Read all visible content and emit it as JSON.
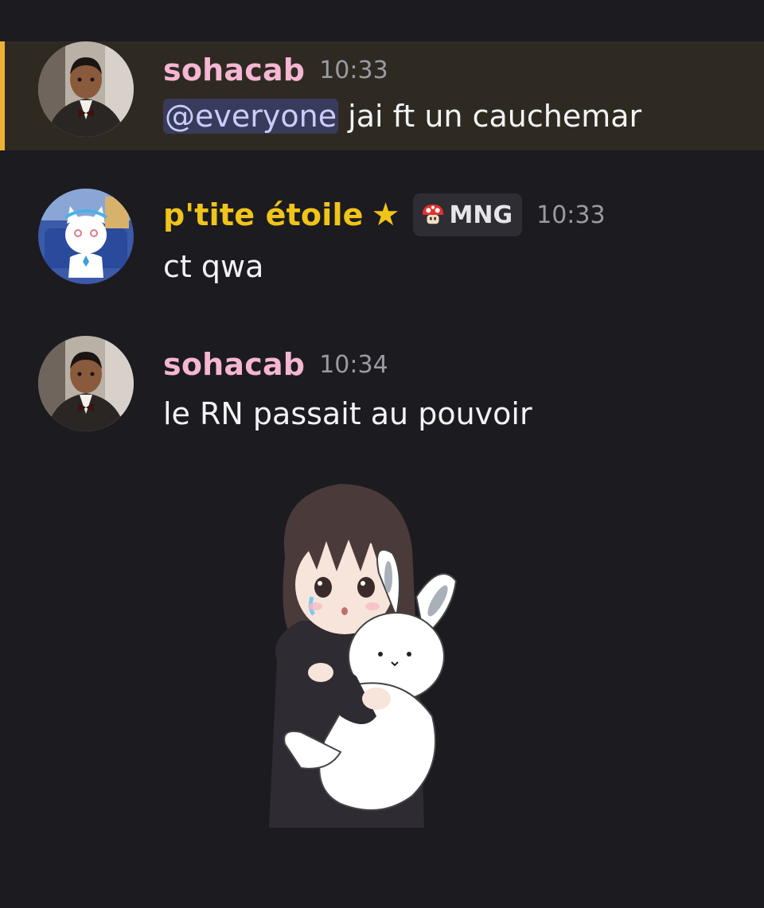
{
  "colors": {
    "background": "#1c1b20",
    "mention_highlight_bg": "#2e2a22",
    "mention_highlight_bar": "#f0b232",
    "username_sohacab": "#f5b6d3",
    "username_ptite": "#f0c419",
    "mention_pill_bg": "#393b5c",
    "mention_pill_text": "#c9cdfb",
    "timestamp": "#9a9aa2"
  },
  "messages": [
    {
      "author": "sohacab",
      "time": "10:33",
      "mention": "@everyone",
      "text": " jai ft un cauchemar",
      "avatar_icon": "boy-in-suit-avatar",
      "highlighted": true
    },
    {
      "author": "p'tite étoile",
      "author_decoration": "★",
      "role": {
        "icon": "mushroom-icon",
        "label": "MNG"
      },
      "time": "10:33",
      "text": "ct qwa",
      "avatar_icon": "white-cat-avatar"
    },
    {
      "author": "sohacab",
      "time": "10:34",
      "text": "le RN passait au pouvoir",
      "avatar_icon": "boy-in-suit-avatar",
      "sticker": "crying-girl-hugging-bunny-sticker"
    }
  ]
}
